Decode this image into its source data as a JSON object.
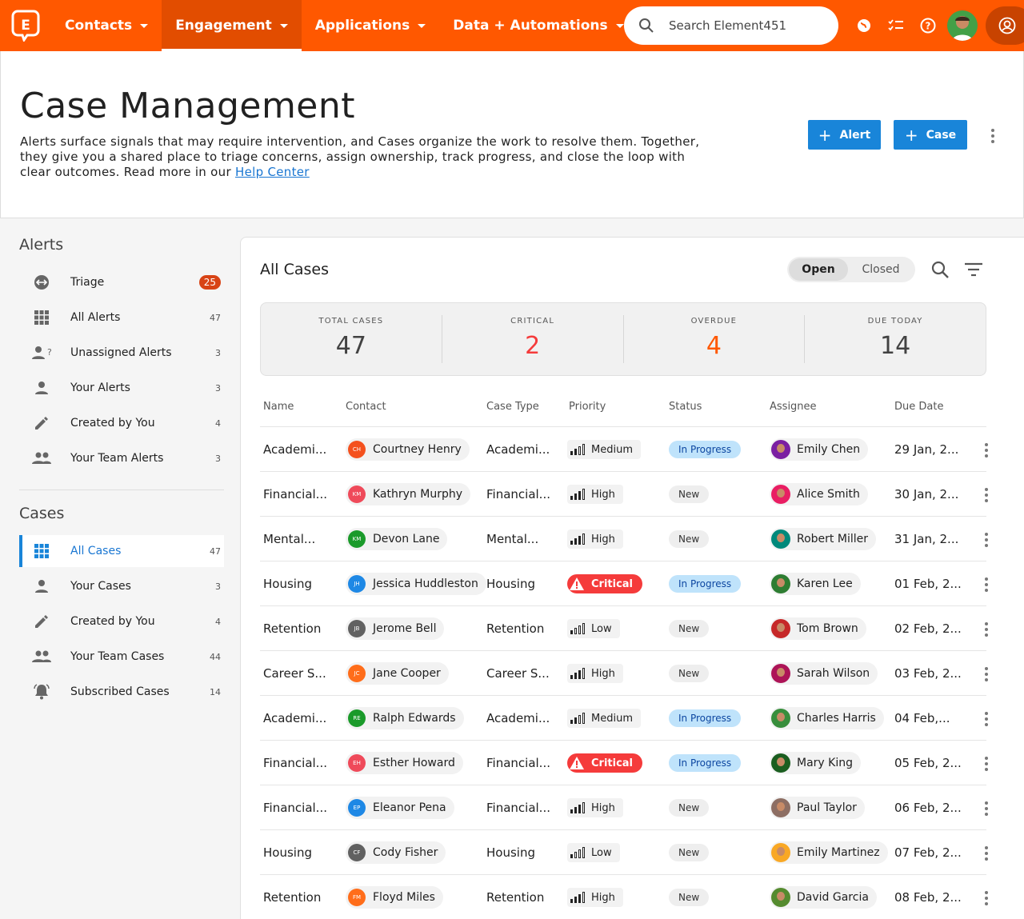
{
  "topnav": {
    "nav": [
      {
        "label": "Contacts"
      },
      {
        "label": "Engagement"
      },
      {
        "label": "Applications"
      },
      {
        "label": "Data + Automations"
      }
    ],
    "search_placeholder": "Search Element451"
  },
  "header": {
    "title": "Case Management",
    "description": "Alerts surface signals that may require intervention, and Cases organize the work to resolve them. Together, they give you a shared place to triage concerns, assign ownership, track progress, and close the loop with clear outcomes. Read more in our",
    "help_link": "Help Center",
    "alert_button": "Alert",
    "case_button": "Case"
  },
  "sidebar": {
    "alerts_heading": "Alerts",
    "alerts": [
      {
        "label": "Triage",
        "count": "25",
        "icon": "triage-icon"
      },
      {
        "label": "All Alerts",
        "count": "47",
        "icon": "grid-icon"
      },
      {
        "label": "Unassigned Alerts",
        "count": "3",
        "icon": "person-question-icon"
      },
      {
        "label": "Your Alerts",
        "count": "3",
        "icon": "person-icon"
      },
      {
        "label": "Created by You",
        "count": "4",
        "icon": "pencil-icon"
      },
      {
        "label": "Your Team Alerts",
        "count": "3",
        "icon": "group-icon"
      }
    ],
    "cases_heading": "Cases",
    "cases": [
      {
        "label": "All Cases",
        "count": "47",
        "icon": "grid-icon"
      },
      {
        "label": "Your Cases",
        "count": "3",
        "icon": "person-icon"
      },
      {
        "label": "Created by You",
        "count": "4",
        "icon": "pencil-icon"
      },
      {
        "label": "Your Team Cases",
        "count": "44",
        "icon": "group-icon"
      },
      {
        "label": "Subscribed Cases",
        "count": "14",
        "icon": "bell-icon"
      }
    ]
  },
  "main": {
    "title": "All Cases",
    "toggle": {
      "open": "Open",
      "closed": "Closed"
    },
    "stats": [
      {
        "label": "TOTAL CASES",
        "value": "47",
        "color": "#424242"
      },
      {
        "label": "CRITICAL",
        "value": "2",
        "color": "#f53b3b"
      },
      {
        "label": "OVERDUE",
        "value": "4",
        "color": "#ff5800"
      },
      {
        "label": "DUE TODAY",
        "value": "14",
        "color": "#424242"
      }
    ],
    "columns": [
      "Name",
      "Contact",
      "Case Type",
      "Priority",
      "Status",
      "Assignee",
      "Due Date"
    ],
    "rows": [
      {
        "name": "Academi...",
        "contact": "Courtney Henry",
        "initials": "CH",
        "ini_color": "#f4511e",
        "type": "Academi...",
        "priority": "Medium",
        "status": "In Progress",
        "assignee": "Emily Chen",
        "due": "29 Jan, 2..."
      },
      {
        "name": "Financial...",
        "contact": "Kathryn Murphy",
        "initials": "KM",
        "ini_color": "#ef4a5a",
        "type": "Financial...",
        "priority": "High",
        "status": "New",
        "assignee": "Alice Smith",
        "due": "30 Jan, 2..."
      },
      {
        "name": "Mental...",
        "contact": "Devon Lane",
        "initials": "KM",
        "ini_color": "#1a9a2a",
        "type": "Mental...",
        "priority": "High",
        "status": "New",
        "assignee": "Robert Miller",
        "due": "31 Jan, 2..."
      },
      {
        "name": "Housing",
        "contact": "Jessica Huddleston",
        "initials": "JH",
        "ini_color": "#1e88e5",
        "type": "Housing",
        "priority": "Critical",
        "status": "In Progress",
        "assignee": "Karen Lee",
        "due": "01 Feb, 2..."
      },
      {
        "name": "Retention",
        "contact": "Jerome Bell",
        "initials": "JB",
        "ini_color": "#616161",
        "type": "Retention",
        "priority": "Low",
        "status": "New",
        "assignee": "Tom Brown",
        "due": "02 Feb, 2..."
      },
      {
        "name": "Career S...",
        "contact": "Jane Cooper",
        "initials": "JC",
        "ini_color": "#ff6d1a",
        "type": "Career S...",
        "priority": "High",
        "status": "New",
        "assignee": "Sarah Wilson",
        "due": "03 Feb, 2..."
      },
      {
        "name": "Academi...",
        "contact": "Ralph Edwards",
        "initials": "RE",
        "ini_color": "#1a9a2a",
        "type": "Academi...",
        "priority": "Medium",
        "status": "In Progress",
        "assignee": "Charles Harris",
        "due": "04 Feb,..."
      },
      {
        "name": "Financial...",
        "contact": "Esther Howard",
        "initials": "EH",
        "ini_color": "#ef4a5a",
        "type": "Financial...",
        "priority": "Critical",
        "status": "In Progress",
        "assignee": "Mary King",
        "due": "05 Feb, 2..."
      },
      {
        "name": "Financial...",
        "contact": "Eleanor Pena",
        "initials": "EP",
        "ini_color": "#1e88e5",
        "type": "Financial...",
        "priority": "High",
        "status": "New",
        "assignee": "Paul Taylor",
        "due": "06 Feb, 2..."
      },
      {
        "name": "Housing",
        "contact": "Cody Fisher",
        "initials": "CF",
        "ini_color": "#616161",
        "type": "Housing",
        "priority": "Low",
        "status": "New",
        "assignee": "Emily Martinez",
        "due": "07 Feb, 2..."
      },
      {
        "name": "Retention",
        "contact": "Floyd Miles",
        "initials": "FM",
        "ini_color": "#ff6d1a",
        "type": "Retention",
        "priority": "High",
        "status": "New",
        "assignee": "David Garcia",
        "due": "08 Feb, 2..."
      }
    ]
  }
}
